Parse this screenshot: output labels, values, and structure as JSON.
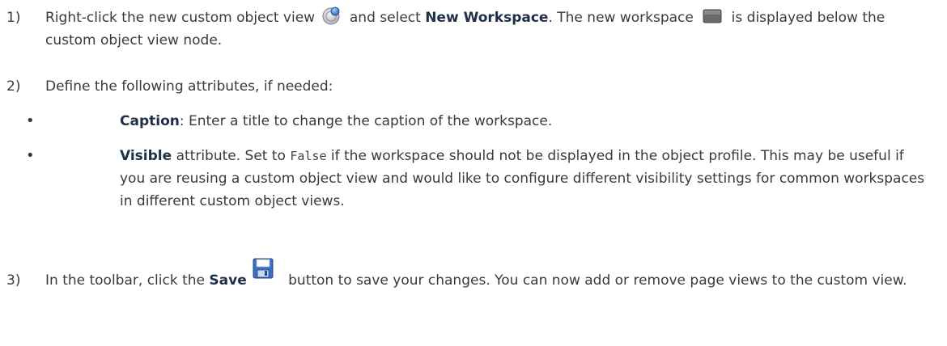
{
  "steps": [
    {
      "num": "1)",
      "pre": "Right-click the new custom object view ",
      "mid": " and select ",
      "bold": "New Workspace",
      "post": ". The new workspace ",
      "tail": " is displayed below the custom object view node."
    },
    {
      "num": "2)",
      "text": "Define the following attributes, if needed:"
    },
    {
      "num": "3)",
      "pre": "In the toolbar, click the ",
      "bold": "Save",
      "post": " button to save your changes. You can now add or remove page views to the custom view."
    }
  ],
  "bullets": [
    {
      "dot": "•",
      "bold": "Caption",
      "text": ": Enter a title to change the caption of the workspace."
    },
    {
      "dot": "•",
      "bold": "Visible",
      "pre": " attribute. Set to ",
      "code": "False",
      "post": " if the workspace should not be displayed in the object profile. This may be useful if you are reusing a custom object view and would like to configure different visibility settings for common workspaces in different custom object views."
    }
  ],
  "icons": {
    "custom_object_view": "custom-object-view-icon",
    "workspace": "workspace-icon",
    "save": "save-icon"
  }
}
